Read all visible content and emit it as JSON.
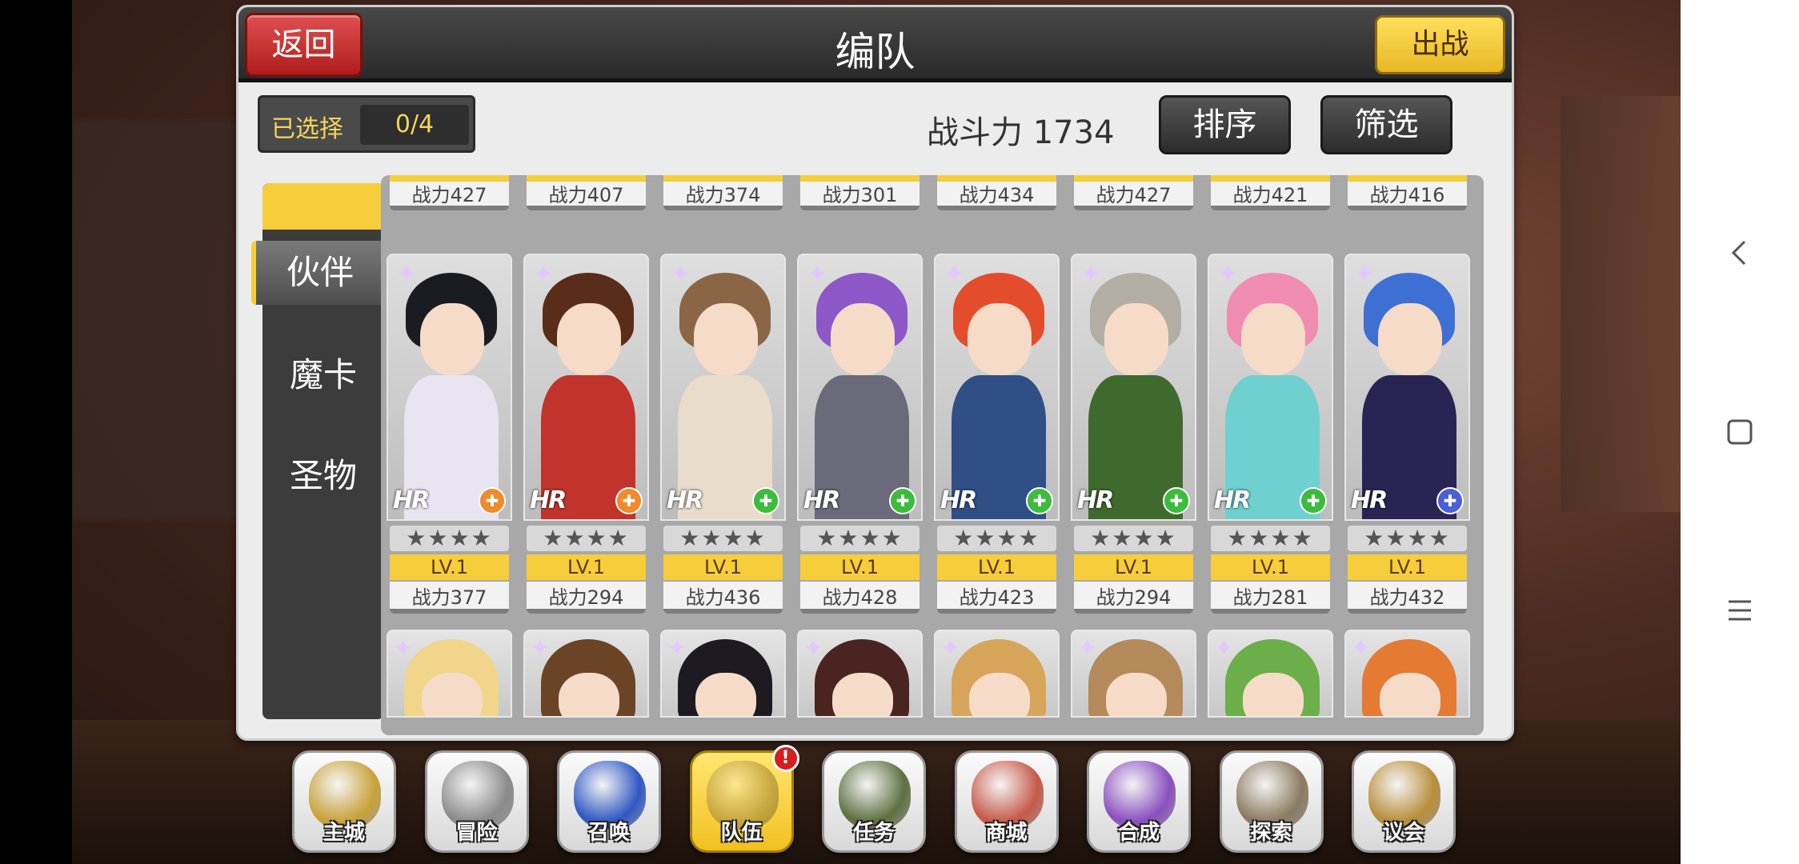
{
  "header": {
    "title": "编队",
    "back_label": "返回",
    "go_label": "出战"
  },
  "selection": {
    "label": "已选择",
    "value": "0/4"
  },
  "power": {
    "label": "战斗力",
    "value": "1734"
  },
  "buttons": {
    "sort": "排序",
    "filter": "筛选"
  },
  "tabs": [
    {
      "label": "伙伴",
      "active": true
    },
    {
      "label": "魔卡",
      "active": false
    },
    {
      "label": "圣物",
      "active": false
    }
  ],
  "top_row_power": [
    "战力427",
    "战力407",
    "战力374",
    "战力301",
    "战力434",
    "战力427",
    "战力421",
    "战力416"
  ],
  "cards": [
    {
      "rarity": "HR",
      "stars": "★★★★",
      "level": "LV.1",
      "power": "战力377",
      "class_color": "#f08a2a",
      "class_icon": "sword-icon",
      "hair": "#1b1b22",
      "outfit": "#e9e4f2"
    },
    {
      "rarity": "HR",
      "stars": "★★★★",
      "level": "LV.1",
      "power": "战力294",
      "class_color": "#f08a2a",
      "class_icon": "cross-icon",
      "hair": "#5a2c1a",
      "outfit": "#c2332b"
    },
    {
      "rarity": "HR",
      "stars": "★★★★",
      "level": "LV.1",
      "power": "战力436",
      "class_color": "#3dbb3d",
      "class_icon": "leaf-icon",
      "hair": "#8a6647",
      "outfit": "#e9dccb"
    },
    {
      "rarity": "HR",
      "stars": "★★★★",
      "level": "LV.1",
      "power": "战力428",
      "class_color": "#3dbb3d",
      "class_icon": "leaf-icon",
      "hair": "#8d57c7",
      "outfit": "#6a6a7a"
    },
    {
      "rarity": "HR",
      "stars": "★★★★",
      "level": "LV.1",
      "power": "战力423",
      "class_color": "#3dbb3d",
      "class_icon": "shield-icon",
      "hair": "#e44d2c",
      "outfit": "#2f4f86"
    },
    {
      "rarity": "HR",
      "stars": "★★★★",
      "level": "LV.1",
      "power": "战力294",
      "class_color": "#3dbb3d",
      "class_icon": "cross-icon",
      "hair": "#b3aea4",
      "outfit": "#3f6a2d"
    },
    {
      "rarity": "HR",
      "stars": "★★★★",
      "level": "LV.1",
      "power": "战力281",
      "class_color": "#3dbb3d",
      "class_icon": "cross-icon",
      "hair": "#f08cb0",
      "outfit": "#6fd0d0"
    },
    {
      "rarity": "HR",
      "stars": "★★★★",
      "level": "LV.1",
      "power": "战力432",
      "class_color": "#4b5fd6",
      "class_icon": "shield-icon",
      "hair": "#3e6fd3",
      "outfit": "#2a2455"
    }
  ],
  "bottom_row_hair": [
    "#f1d58a",
    "#6b4426",
    "#1d1a22",
    "#4a2420",
    "#d7a55a",
    "#b48a5a",
    "#6cae4a",
    "#e57a32"
  ],
  "menu": [
    {
      "label": "主城",
      "color": "#c9a23a",
      "active": false
    },
    {
      "label": "冒险",
      "color": "#8b8b8b",
      "active": false
    },
    {
      "label": "召唤",
      "color": "#2f58c4",
      "active": false
    },
    {
      "label": "队伍",
      "color": "#c7a63e",
      "active": true,
      "badge": "!"
    },
    {
      "label": "任务",
      "color": "#5d7040",
      "active": false
    },
    {
      "label": "商城",
      "color": "#c75a4a",
      "active": false
    },
    {
      "label": "合成",
      "color": "#8a4fc0",
      "active": false
    },
    {
      "label": "探索",
      "color": "#8a7a60",
      "active": false
    },
    {
      "label": "议会",
      "color": "#b88e3a",
      "active": false
    }
  ]
}
